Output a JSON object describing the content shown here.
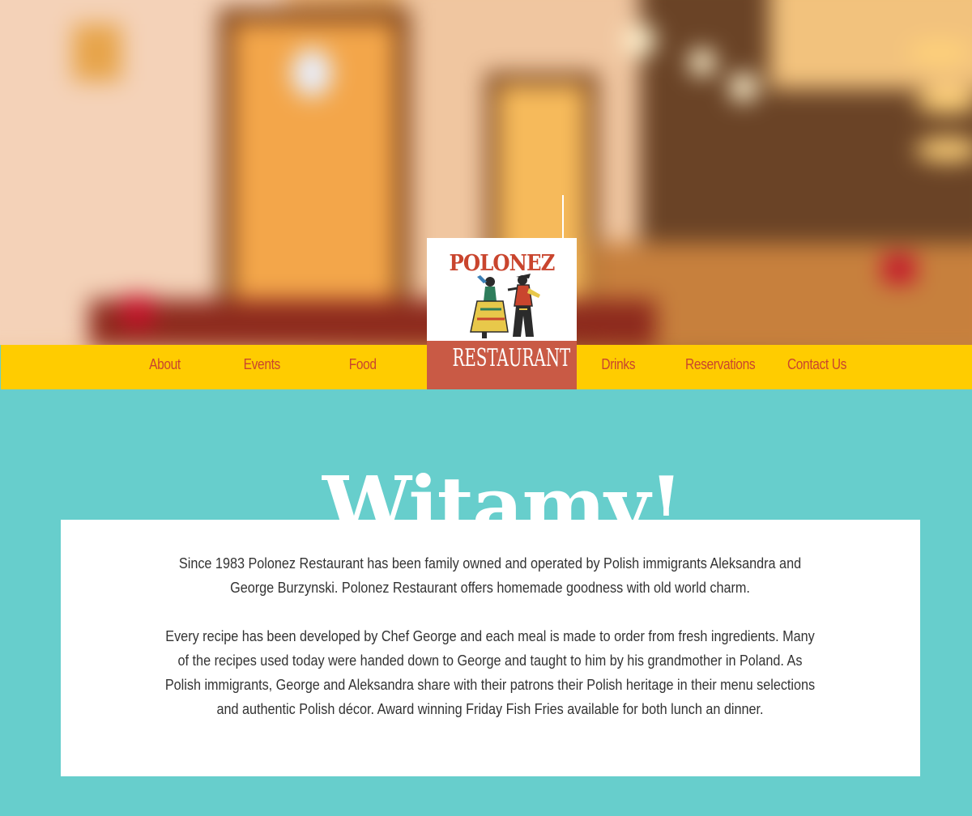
{
  "nav": {
    "items": [
      {
        "label": "About"
      },
      {
        "label": "Events"
      },
      {
        "label": "Food"
      },
      {
        "label": "Drinks"
      },
      {
        "label": "Reservations"
      },
      {
        "label": "Contact Us"
      }
    ]
  },
  "logo": {
    "top_text": "POLONEZ",
    "bottom_text": "RESTAURANT",
    "brand_red": "#c9452e",
    "banner_red": "#c95a45"
  },
  "main": {
    "heading": "Witamy!",
    "paragraphs": [
      "Since 1983 Polonez Restaurant has been family owned and operated by Polish immigrants Aleksandra and George Burzynski. Polonez Restaurant offers homemade goodness with old world charm.",
      "Every recipe has been developed by Chef George and each meal is made to order from fresh ingredients. Many of the recipes used today were handed down to George and taught to him by his grandmother in Poland. As Polish immigrants, George and Aleksandra share with their patrons their Polish heritage in their menu selections and authentic Polish décor. Award winning Friday Fish Fries available for both lunch an dinner."
    ]
  },
  "colors": {
    "nav_background": "#ffcc00",
    "nav_text": "#c9452e",
    "page_background": "#67cecc",
    "heading": "#ffffff",
    "card_background": "#ffffff",
    "body_text": "#333333"
  }
}
